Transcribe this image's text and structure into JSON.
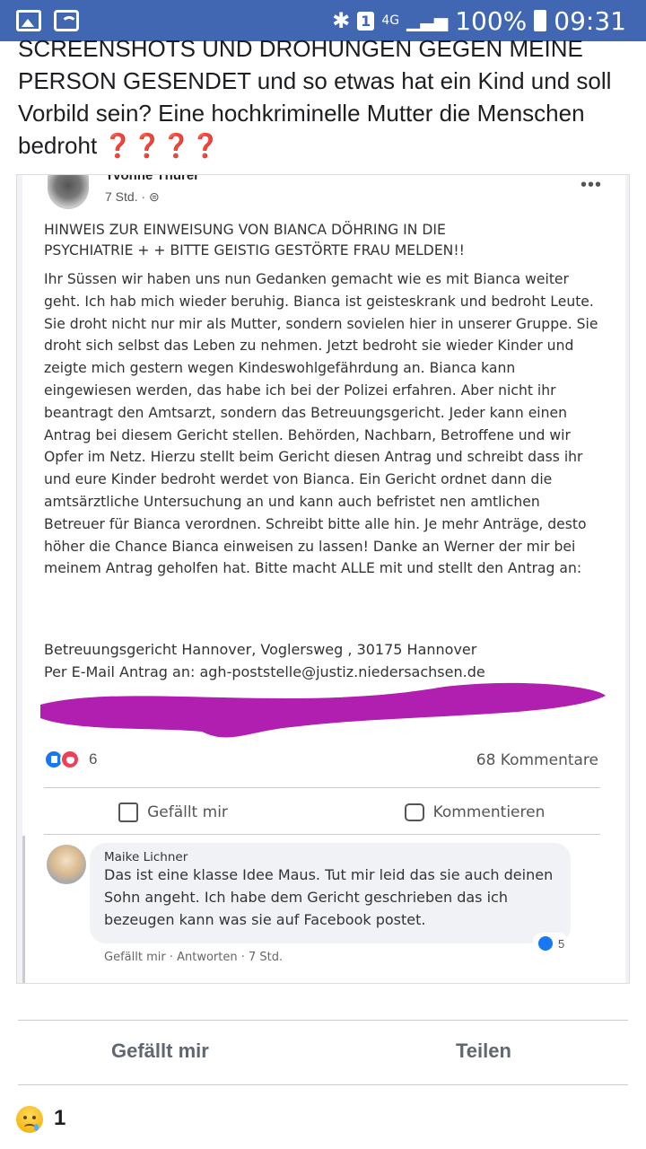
{
  "status_bar": {
    "bluetooth": "bluetooth-icon",
    "sim": "1",
    "network": "4G",
    "battery": "100%",
    "time": "09:31"
  },
  "caption": {
    "text": "SCREENSHOTS UND DROHUNGEN GEGEN MEINE PERSON GESENDET und so etwas hat ein Kind und soll Vorbild sein? Eine hochkriminelle Mutter die Menschen bedroht ❓❓❓❓"
  },
  "screenshot": {
    "post": {
      "author": "Yvonne Thurer",
      "time": "7 Std. · ⊜",
      "title": "HINWEIS ZUR EINWEISUNG VON BIANCA DÖHRING IN DIE PSYCHIATRIE + + BITTE GEISTIG GESTÖRTE FRAU MELDEN!!",
      "body": "Ihr Süssen wir haben uns nun Gedanken gemacht wie es mit Bianca weiter geht. Ich hab mich wieder beruhig. Bianca ist geisteskrank und bedroht Leute. Sie droht nicht nur mir als Mutter, sondern sovielen hier in unserer Gruppe. Sie droht sich selbst das Leben zu nehmen. Jetzt bedroht sie wieder Kinder und zeigte mich gestern wegen Kindeswohlgefährdung an. Bianca kann eingewiesen werden, das habe ich bei der Polizei erfahren. Aber nicht ihr beantragt den Amtsarzt, sondern das Betreuungsgericht. Jeder kann einen Antrag bei diesem Gericht stellen. Behörden, Nachbarn, Betroffene und wir Opfer im Netz. Hierzu stellt beim Gericht diesen Antrag und schreibt dass ihr und eure Kinder bedroht werdet von Bianca. Ein Gericht ordnet dann die amtsärztliche Untersuchung an und kann auch befristet nen amtlichen Betreuer für Bianca verordnen. Schreibt bitte alle hin. Je mehr Anträge, desto höher die Chance Bianca einweisen zu lassen! Danke an Werner der mir bei meinem Antrag geholfen hat. Bitte macht ALLE mit und stellt den Antrag an:",
      "address_line1": "Betreuungsgericht Hannover, Voglersweg , 30175 Hannover",
      "address_line2": "Per E-Mail Antrag an: agh-poststelle@justiz.niedersachsen.de",
      "redaction_color": "#b11fb0",
      "reaction_count": "6",
      "comments_count": "68 Kommentare",
      "like_label": "Gefällt mir",
      "comment_label": "Kommentieren"
    },
    "comment": {
      "name": "Maike Lichner",
      "text": "Das ist eine klasse Idee Maus. Tut mir leid das sie auch deinen Sohn angeht. Ich habe dem Gericht geschrieben das ich bezeugen kann was sie auf Facebook postet.",
      "meta": "Gefällt mir · Antworten · 7 Std.",
      "likes": "5"
    }
  },
  "bottom_actions": {
    "like": "Gefällt mir",
    "share": "Teilen",
    "reaction_count": "1"
  },
  "colors": {
    "status_bar": "#4267b2",
    "like_blue": "#1877f2",
    "love_red": "#f33e58"
  }
}
